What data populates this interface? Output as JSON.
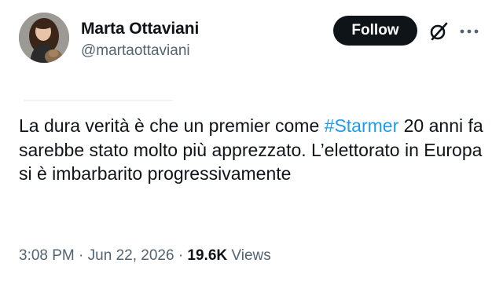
{
  "author": {
    "name": "Marta Ottaviani",
    "handle": "@martaottaviani",
    "avatar_icon": "profile-photo"
  },
  "actions": {
    "follow_label": "Follow",
    "grok_icon": "grok-icon",
    "more_icon": "more-horizontal-icon"
  },
  "tweet": {
    "text_before": "La dura verità è che un premier come ",
    "hashtag": "#Starmer",
    "text_after": " 20 anni fa sarebbe stato molto più apprezzato. L’elettorato in Europa si è imbarbarito progressivamente"
  },
  "meta": {
    "time": "3:08 PM",
    "separator": "·",
    "date": "Jun 22, 2026",
    "views_count": "19.6K",
    "views_label": "Views"
  },
  "colors": {
    "text": "#0f1419",
    "secondary": "#536471",
    "link": "#1d9bf0",
    "button": "#0f1419"
  }
}
